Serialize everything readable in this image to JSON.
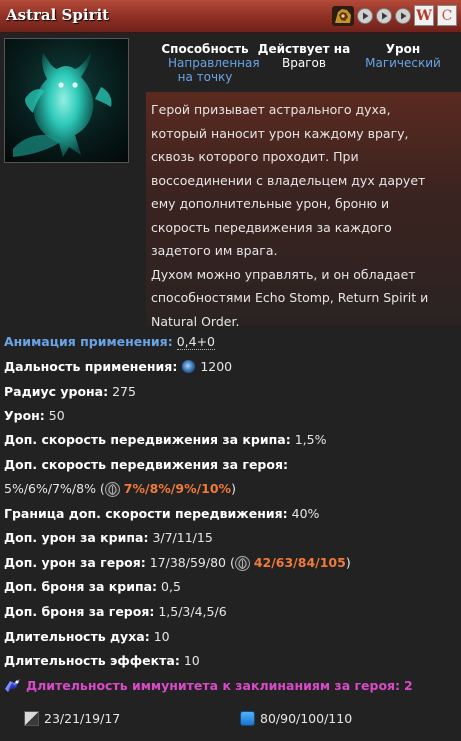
{
  "header": {
    "title": "Astral Spirit",
    "buttons": {
      "w_label": "W",
      "c_label": "C"
    }
  },
  "ability_meta": {
    "ability_label": "Способность",
    "ability_value": "Направленная на точку",
    "targets_label": "Действует на",
    "targets_value": "Врагов",
    "damage_label": "Урон",
    "damage_value": "Магический"
  },
  "description": {
    "line1": "Герой призывает астрального духа,",
    "line2": "который наносит урон каждому врагу,",
    "line3": "сквозь которого проходит. При",
    "line4": "воссоединении с владельцем дух дарует",
    "line5": "ему дополнительные урон, броню и",
    "line6": "скорость передвижения за каждого",
    "line7": "задетого им врага.",
    "line8": "Духом можно управлять, и он обладает",
    "line9": "способностями Echo Stomp, Return Spirit и",
    "line10": "Natural Order."
  },
  "stats": {
    "cast_anim_label": "Анимация применения:",
    "cast_anim_value": "0,4+0",
    "cast_range_label": "Дальность применения:",
    "cast_range_value": "1200",
    "radius_label": "Радиус урона:",
    "radius_value": "275",
    "damage_label": "Урон:",
    "damage_value": "50",
    "ms_creep_label": "Доп. скорость передвижения за крипа:",
    "ms_creep_value": "1,5%",
    "ms_hero_label": "Доп. скорость передвижения за героя:",
    "ms_hero_value": "5%/6%/7%/8% (",
    "ms_hero_scepter": "7%/8%/9%/10%",
    "ms_hero_close": ")",
    "ms_cap_label": "Граница доп. скорости передвижения:",
    "ms_cap_value": "40%",
    "dmg_creep_label": "Доп. урон за крипа:",
    "dmg_creep_value": "3/7/11/15",
    "dmg_hero_label": "Доп. урон за героя:",
    "dmg_hero_value": "17/38/59/80 (",
    "dmg_hero_scepter": "42/63/84/105",
    "dmg_hero_close": ")",
    "armor_creep_label": "Доп. броня за крипа:",
    "armor_creep_value": "0,5",
    "armor_hero_label": "Доп. броня за героя:",
    "armor_hero_value": "1,5/3/4,5/6",
    "spirit_dur_label": "Длительность духа:",
    "spirit_dur_value": "10",
    "effect_dur_label": "Длительность эффекта:",
    "effect_dur_value": "10",
    "immunity_label": "Длительность иммунитета к заклинаниям за героя:",
    "immunity_value": "2"
  },
  "footer": {
    "cooldown_value": "23/21/19/17",
    "mana_value": "80/90/100/110"
  },
  "colors": {
    "title_bar": "#8e2f24",
    "accent_blue": "#6aa4e6",
    "scepter_orange": "#f07a3a",
    "immunity_purple": "#d84bc8",
    "background": "#222222"
  }
}
